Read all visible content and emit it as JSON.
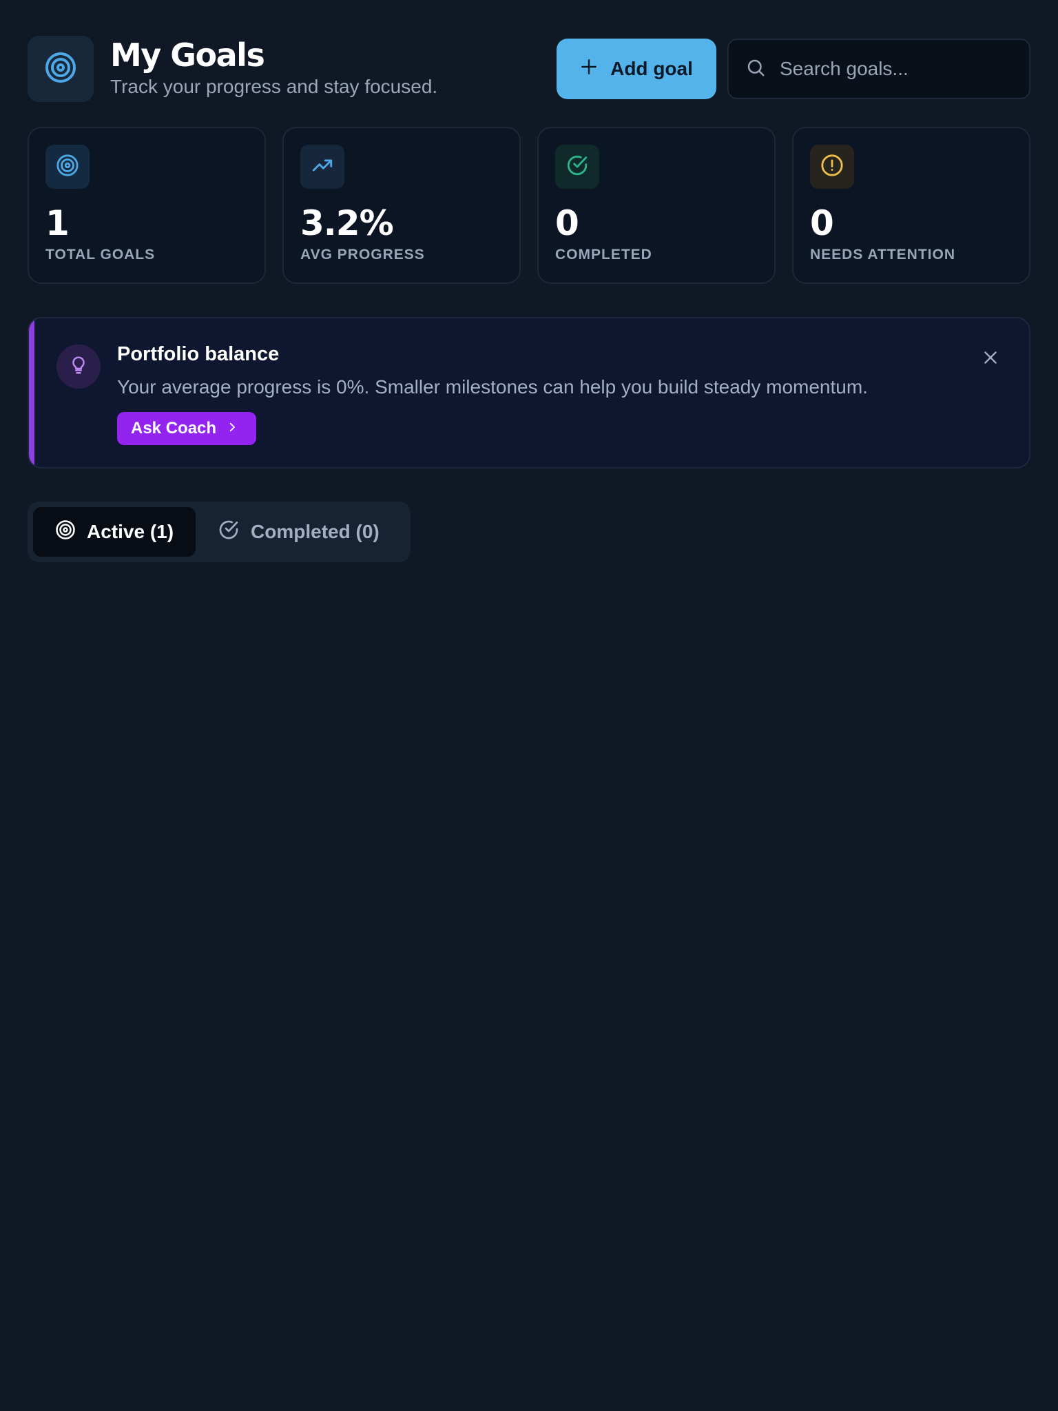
{
  "header": {
    "title": "My Goals",
    "subtitle": "Track your progress and stay focused.",
    "logo_icon": "target-icon",
    "add_button_label": "Add goal",
    "search_placeholder": "Search goals..."
  },
  "stats": [
    {
      "icon": "target-icon",
      "value": "1",
      "label": "TOTAL GOALS",
      "accent": "#4ea8e6"
    },
    {
      "icon": "trending-up-icon",
      "value": "3.2%",
      "label": "AVG PROGRESS",
      "accent": "#4ea8e6"
    },
    {
      "icon": "check-circle-icon",
      "value": "0",
      "label": "COMPLETED",
      "accent": "#2bb58a"
    },
    {
      "icon": "alert-circle-icon",
      "value": "0",
      "label": "NEEDS ATTENTION",
      "accent": "#f0bd48"
    }
  ],
  "banner": {
    "icon": "lightbulb-icon",
    "title": "Portfolio balance",
    "text": "Your average progress is 0%. Smaller milestones can help you build steady momentum.",
    "button_label": "Ask Coach",
    "accent": "#8e3fe0"
  },
  "tabs": [
    {
      "icon": "target-icon",
      "label": "Active (1)",
      "active": true
    },
    {
      "icon": "check-circle-icon",
      "label": "Completed (0)",
      "active": false
    }
  ],
  "colors": {
    "background": "#0f1824",
    "primary": "#55b3ec",
    "coach_button": "#9323ee"
  }
}
